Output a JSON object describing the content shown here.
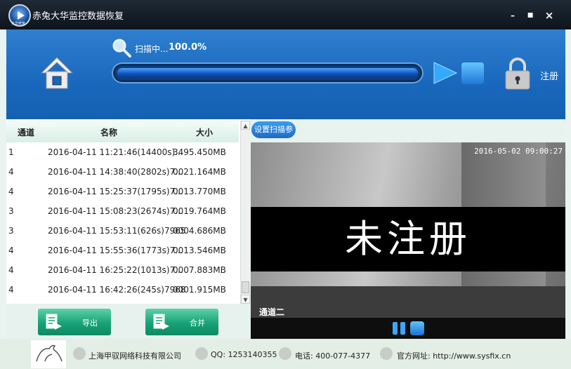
{
  "app": {
    "title": "赤兔大华监控数据恢复",
    "logo_caption": "大华修复"
  },
  "window_controls": {
    "minimize": "–",
    "maximize": "■",
    "close": "×"
  },
  "header": {
    "scan_status": "扫描中...",
    "scan_percent_text": "100.0%",
    "progress_fraction": 1.0,
    "register_label": "注册"
  },
  "table": {
    "columns": [
      "通道",
      "名称",
      "大小"
    ],
    "rows": [
      {
        "channel": "1",
        "name": "2016-04-11 11:21:46(14400s)...",
        "size": "3495.450MB"
      },
      {
        "channel": "4",
        "name": "2016-04-11 14:38:40(2802s)7...",
        "size": "0021.164MB"
      },
      {
        "channel": "4",
        "name": "2016-04-11 15:25:37(1795s)7...",
        "size": "0013.770MB"
      },
      {
        "channel": "3",
        "name": "2016-04-11 15:08:23(2674s)7...",
        "size": "0019.764MB"
      },
      {
        "channel": "3",
        "name": "2016-04-11 15:53:11(626s)7965",
        "size": "0004.686MB"
      },
      {
        "channel": "4",
        "name": "2016-04-11 15:55:36(1773s)7...",
        "size": "0013.546MB"
      },
      {
        "channel": "4",
        "name": "2016-04-11 16:25:22(1013s)7...",
        "size": "0007.883MB"
      },
      {
        "channel": "4",
        "name": "2016-04-11 16:42:26(245s)7968",
        "size": "0001.915MB"
      }
    ]
  },
  "buttons": {
    "export": "导出",
    "merge": "合并",
    "settings": "设置扫描参数"
  },
  "video": {
    "timestamp": "2016-05-02 09:00:27",
    "overlay_text": "未注册",
    "channel_label": "通道二"
  },
  "footer": {
    "company": "上海甲驭网络科技有限公司",
    "qq": "QQ: 1253140355",
    "phone": "电话: 400-077-4377",
    "website": "官方网址: http://www.sysfix.cn"
  },
  "colors": {
    "header_blue": "#1968bd",
    "button_green": "#17a276",
    "titlebar": "#141c26"
  }
}
